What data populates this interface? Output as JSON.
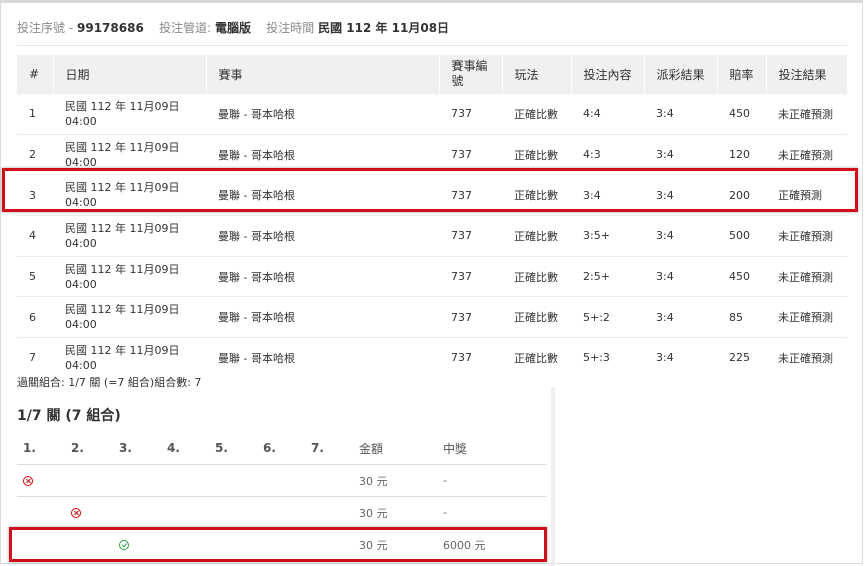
{
  "header": {
    "serial_label": "投注序號",
    "serial_value": "99178686",
    "channel_label": "投注管道:",
    "channel_value": "電腦版",
    "time_label": "投注時間",
    "time_value": "民國 112 年 11月08日"
  },
  "bets_table": {
    "columns": [
      "#",
      "日期",
      "賽事",
      "賽事編號",
      "玩法",
      "投注內容",
      "派彩結果",
      "賠率",
      "投注結果"
    ],
    "rows": [
      {
        "no": "1",
        "date1": "民國 112 年 11月09日",
        "date2": "04:00",
        "match": "曼聯 - 哥本哈根",
        "match_id": "737",
        "play": "正確比數",
        "pick": "4:4",
        "result": "3:4",
        "odds": "450",
        "outcome": "未正確預測"
      },
      {
        "no": "2",
        "date1": "民國 112 年 11月09日",
        "date2": "04:00",
        "match": "曼聯 - 哥本哈根",
        "match_id": "737",
        "play": "正確比數",
        "pick": "4:3",
        "result": "3:4",
        "odds": "120",
        "outcome": "未正確預測"
      },
      {
        "no": "3",
        "date1": "民國 112 年 11月09日",
        "date2": "04:00",
        "match": "曼聯 - 哥本哈根",
        "match_id": "737",
        "play": "正確比數",
        "pick": "3:4",
        "result": "3:4",
        "odds": "200",
        "outcome": "正確預測"
      },
      {
        "no": "4",
        "date1": "民國 112 年 11月09日",
        "date2": "04:00",
        "match": "曼聯 - 哥本哈根",
        "match_id": "737",
        "play": "正確比數",
        "pick": "3:5+",
        "result": "3:4",
        "odds": "500",
        "outcome": "未正確預測"
      },
      {
        "no": "5",
        "date1": "民國 112 年 11月09日",
        "date2": "04:00",
        "match": "曼聯 - 哥本哈根",
        "match_id": "737",
        "play": "正確比數",
        "pick": "2:5+",
        "result": "3:4",
        "odds": "450",
        "outcome": "未正確預測"
      },
      {
        "no": "6",
        "date1": "民國 112 年 11月09日",
        "date2": "04:00",
        "match": "曼聯 - 哥本哈根",
        "match_id": "737",
        "play": "正確比數",
        "pick": "5+:2",
        "result": "3:4",
        "odds": "85",
        "outcome": "未正確預測"
      },
      {
        "no": "7",
        "date1": "民國 112 年 11月09日",
        "date2": "04:00",
        "match": "曼聯 - 哥本哈根",
        "match_id": "737",
        "play": "正確比數",
        "pick": "5+:3",
        "result": "3:4",
        "odds": "225",
        "outcome": "未正確預測"
      }
    ]
  },
  "summary_text": "過關組合: 1/7 關 (=7 組合)組合數: 7",
  "combo_title": "1/7 關 (7 組合)",
  "combo_table": {
    "columns": [
      "1.",
      "2.",
      "3.",
      "4.",
      "5.",
      "6.",
      "7.",
      "金額",
      "中獎"
    ],
    "rows": [
      {
        "amount": "30 元",
        "prize": "-"
      },
      {
        "amount": "30 元",
        "prize": "-"
      },
      {
        "amount": "30 元",
        "prize": "6000 元"
      }
    ]
  },
  "colors": {
    "highlight_border": "#d10f1a",
    "header_bg": "#f0f0f0",
    "lost_icon": "#d10f1a",
    "won_icon": "#2ea043"
  }
}
